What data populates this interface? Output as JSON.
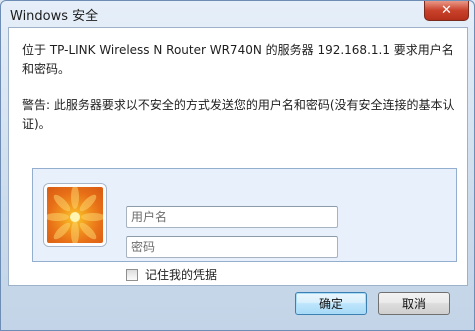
{
  "window": {
    "title": "Windows 安全"
  },
  "message": {
    "line1": "位于 TP-LINK Wireless N Router WR740N 的服务器 192.168.1.1 要求用户名和密码。",
    "warning": "警告: 此服务器要求以不安全的方式发送您的用户名和密码(没有安全连接的基本认证)。"
  },
  "credentials": {
    "username_placeholder": "用户名",
    "password_placeholder": "密码",
    "remember_label": "记住我的凭据"
  },
  "buttons": {
    "ok_label": "确定",
    "cancel_label": "取消"
  },
  "icons": {
    "close": "close-icon",
    "avatar": "user-tile-flower-icon"
  },
  "colors": {
    "close_button": "#c9412b",
    "credential_panel": "#e7f0fb",
    "chrome": "#cddcec"
  }
}
